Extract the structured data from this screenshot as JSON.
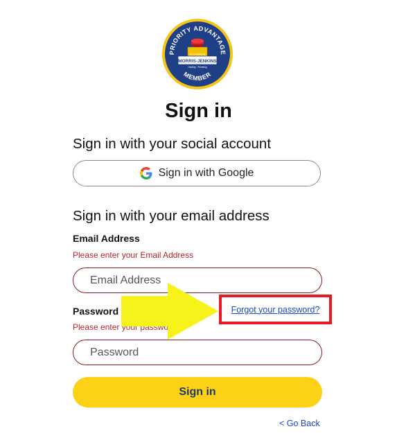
{
  "logo": {
    "top_text": "PRIORITY ADVANTAGE",
    "bottom_text": "MEMBER",
    "brand": "MORRIS-JENKINS",
    "tagline_top": "Air Conditioning",
    "tagline_bottom": "Heating · Plumbing"
  },
  "page_title": "Sign in",
  "social": {
    "heading": "Sign in with your social account",
    "google_label": "Sign in with Google"
  },
  "email_section": {
    "heading": "Sign in with your email address",
    "email_label": "Email Address",
    "email_error": "Please enter your Email Address",
    "email_placeholder": "Email Address",
    "password_label": "Password",
    "password_error": "Please enter your password",
    "password_placeholder": "Password",
    "forgot_link": "Forgot your password?"
  },
  "signin_button": "Sign in",
  "go_back": "< Go Back",
  "colors": {
    "accent_yellow": "#fcd116",
    "error_red": "#b3262e",
    "link_blue": "#1a46c9",
    "highlight_red": "#e31b23",
    "navy": "#1d3a6a"
  }
}
